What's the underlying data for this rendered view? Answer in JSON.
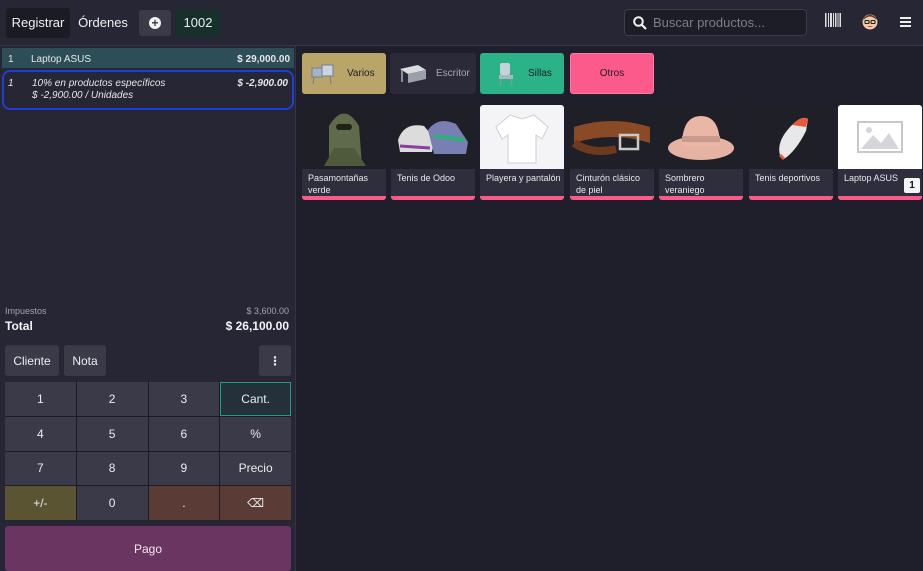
{
  "topbar": {
    "register_label": "Registrar",
    "orders_label": "Órdenes",
    "order_number": "1002",
    "search_placeholder": "Buscar productos..."
  },
  "order_lines": [
    {
      "qty": "1",
      "name": "Laptop ASUS",
      "price": "$ 29,000.00"
    },
    {
      "qty": "1",
      "name": "10% en productos específicos",
      "detail": "$ -2,900.00 / Unidades",
      "price": "$ -2,900.00"
    }
  ],
  "summary": {
    "taxes_label": "Impuestos",
    "taxes_value": "$ 3,600.00",
    "total_label": "Total",
    "total_value": "$ 26,100.00"
  },
  "controls": {
    "customer_label": "Cliente",
    "note_label": "Nota",
    "more_label": "⋮"
  },
  "numpad": {
    "k1": "1",
    "k2": "2",
    "k3": "3",
    "qty": "Cant.",
    "k4": "4",
    "k5": "5",
    "k6": "6",
    "pct": "%",
    "k7": "7",
    "k8": "8",
    "k9": "9",
    "price": "Precio",
    "sign": "+/-",
    "k0": "0",
    "dot": ".",
    "back": "⌫"
  },
  "pay_label": "Pago",
  "categories": [
    {
      "name": "Varios",
      "color": "#b9a569"
    },
    {
      "name": "Escritor",
      "color": "#2a2a38"
    },
    {
      "name": "Sillas",
      "color": "#2cb287"
    },
    {
      "name": "Otros",
      "color": "#fb5a8a"
    }
  ],
  "products": [
    {
      "name": "Pasamontañas verde"
    },
    {
      "name": "Tenis de Odoo"
    },
    {
      "name": "Playera y pantalón"
    },
    {
      "name": "Cinturón clásico de piel"
    },
    {
      "name": "Sombrero veraniego"
    },
    {
      "name": "Tenis deportivos"
    },
    {
      "name": "Laptop ASUS",
      "badge": "1"
    }
  ],
  "icons": {
    "search": "search-icon",
    "barcode": "barcode-icon",
    "avatar": "avatar-icon",
    "menu": "hamburger-menu-icon"
  }
}
